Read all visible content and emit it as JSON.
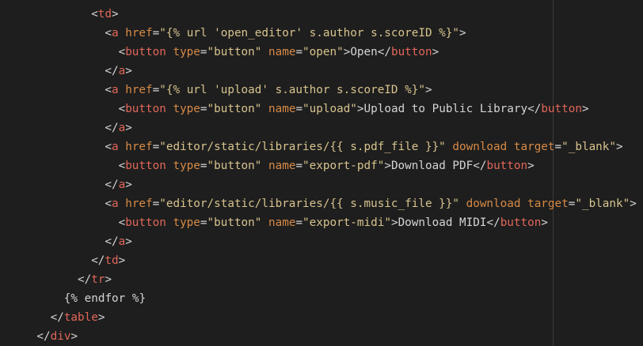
{
  "colors": {
    "background": "#1e1e1e",
    "punctuation": "#d4d4d4",
    "tag": "#e2665a",
    "attribute": "#d78a46",
    "string": "#d7c38e",
    "text": "#d4d4d4"
  },
  "code": {
    "lines": [
      {
        "indent": 12,
        "tokens": [
          {
            "t": "punct",
            "v": "<"
          },
          {
            "t": "tag",
            "v": "td"
          },
          {
            "t": "punct",
            "v": ">"
          }
        ]
      },
      {
        "indent": 14,
        "tokens": [
          {
            "t": "punct",
            "v": "<"
          },
          {
            "t": "tag",
            "v": "a"
          },
          {
            "t": "text",
            "v": " "
          },
          {
            "t": "attr",
            "v": "href"
          },
          {
            "t": "punct",
            "v": "="
          },
          {
            "t": "str",
            "v": "\"{% url 'open_editor' s.author s.scoreID %}\""
          },
          {
            "t": "punct",
            "v": ">"
          }
        ]
      },
      {
        "indent": 16,
        "tokens": [
          {
            "t": "punct",
            "v": "<"
          },
          {
            "t": "tag",
            "v": "button"
          },
          {
            "t": "text",
            "v": " "
          },
          {
            "t": "attr",
            "v": "type"
          },
          {
            "t": "punct",
            "v": "="
          },
          {
            "t": "str",
            "v": "\"button\""
          },
          {
            "t": "text",
            "v": " "
          },
          {
            "t": "attr",
            "v": "name"
          },
          {
            "t": "punct",
            "v": "="
          },
          {
            "t": "str",
            "v": "\"open\""
          },
          {
            "t": "punct",
            "v": ">"
          },
          {
            "t": "text",
            "v": "Open"
          },
          {
            "t": "punct",
            "v": "</"
          },
          {
            "t": "tag",
            "v": "button"
          },
          {
            "t": "punct",
            "v": ">"
          }
        ]
      },
      {
        "indent": 14,
        "tokens": [
          {
            "t": "punct",
            "v": "</"
          },
          {
            "t": "tag",
            "v": "a"
          },
          {
            "t": "punct",
            "v": ">"
          }
        ]
      },
      {
        "indent": 14,
        "tokens": [
          {
            "t": "punct",
            "v": "<"
          },
          {
            "t": "tag",
            "v": "a"
          },
          {
            "t": "text",
            "v": " "
          },
          {
            "t": "attr",
            "v": "href"
          },
          {
            "t": "punct",
            "v": "="
          },
          {
            "t": "str",
            "v": "\"{% url 'upload' s.author s.scoreID %}\""
          },
          {
            "t": "punct",
            "v": ">"
          }
        ]
      },
      {
        "indent": 16,
        "tokens": [
          {
            "t": "punct",
            "v": "<"
          },
          {
            "t": "tag",
            "v": "button"
          },
          {
            "t": "text",
            "v": " "
          },
          {
            "t": "attr",
            "v": "type"
          },
          {
            "t": "punct",
            "v": "="
          },
          {
            "t": "str",
            "v": "\"button\""
          },
          {
            "t": "text",
            "v": " "
          },
          {
            "t": "attr",
            "v": "name"
          },
          {
            "t": "punct",
            "v": "="
          },
          {
            "t": "str",
            "v": "\"upload\""
          },
          {
            "t": "punct",
            "v": ">"
          },
          {
            "t": "text",
            "v": "Upload to Public Library"
          },
          {
            "t": "punct",
            "v": "</"
          },
          {
            "t": "tag",
            "v": "button"
          },
          {
            "t": "punct",
            "v": ">"
          }
        ]
      },
      {
        "indent": 14,
        "tokens": [
          {
            "t": "punct",
            "v": "</"
          },
          {
            "t": "tag",
            "v": "a"
          },
          {
            "t": "punct",
            "v": ">"
          }
        ]
      },
      {
        "indent": 14,
        "tokens": [
          {
            "t": "punct",
            "v": "<"
          },
          {
            "t": "tag",
            "v": "a"
          },
          {
            "t": "text",
            "v": " "
          },
          {
            "t": "attr",
            "v": "href"
          },
          {
            "t": "punct",
            "v": "="
          },
          {
            "t": "str",
            "v": "\"editor/static/libraries/{{ s.pdf_file }}\""
          },
          {
            "t": "text",
            "v": " "
          },
          {
            "t": "attr",
            "v": "download"
          },
          {
            "t": "text",
            "v": " "
          },
          {
            "t": "attr",
            "v": "target"
          },
          {
            "t": "punct",
            "v": "="
          },
          {
            "t": "str",
            "v": "\"_blank\""
          },
          {
            "t": "punct",
            "v": ">"
          }
        ]
      },
      {
        "indent": 16,
        "tokens": [
          {
            "t": "punct",
            "v": "<"
          },
          {
            "t": "tag",
            "v": "button"
          },
          {
            "t": "text",
            "v": " "
          },
          {
            "t": "attr",
            "v": "type"
          },
          {
            "t": "punct",
            "v": "="
          },
          {
            "t": "str",
            "v": "\"button\""
          },
          {
            "t": "text",
            "v": " "
          },
          {
            "t": "attr",
            "v": "name"
          },
          {
            "t": "punct",
            "v": "="
          },
          {
            "t": "str",
            "v": "\"export-pdf\""
          },
          {
            "t": "punct",
            "v": ">"
          },
          {
            "t": "text",
            "v": "Download PDF"
          },
          {
            "t": "punct",
            "v": "</"
          },
          {
            "t": "tag",
            "v": "button"
          },
          {
            "t": "punct",
            "v": ">"
          }
        ]
      },
      {
        "indent": 14,
        "tokens": [
          {
            "t": "punct",
            "v": "</"
          },
          {
            "t": "tag",
            "v": "a"
          },
          {
            "t": "punct",
            "v": ">"
          }
        ]
      },
      {
        "indent": 14,
        "tokens": [
          {
            "t": "punct",
            "v": "<"
          },
          {
            "t": "tag",
            "v": "a"
          },
          {
            "t": "text",
            "v": " "
          },
          {
            "t": "attr",
            "v": "href"
          },
          {
            "t": "punct",
            "v": "="
          },
          {
            "t": "str",
            "v": "\"editor/static/libraries/{{ s.music_file }}\""
          },
          {
            "t": "text",
            "v": " "
          },
          {
            "t": "attr",
            "v": "download"
          },
          {
            "t": "text",
            "v": " "
          },
          {
            "t": "attr",
            "v": "target"
          },
          {
            "t": "punct",
            "v": "="
          },
          {
            "t": "str",
            "v": "\"_blank\""
          },
          {
            "t": "punct",
            "v": ">"
          }
        ]
      },
      {
        "indent": 16,
        "tokens": [
          {
            "t": "punct",
            "v": "<"
          },
          {
            "t": "tag",
            "v": "button"
          },
          {
            "t": "text",
            "v": " "
          },
          {
            "t": "attr",
            "v": "type"
          },
          {
            "t": "punct",
            "v": "="
          },
          {
            "t": "str",
            "v": "\"button\""
          },
          {
            "t": "text",
            "v": " "
          },
          {
            "t": "attr",
            "v": "name"
          },
          {
            "t": "punct",
            "v": "="
          },
          {
            "t": "str",
            "v": "\"export-midi\""
          },
          {
            "t": "punct",
            "v": ">"
          },
          {
            "t": "text",
            "v": "Download MIDI"
          },
          {
            "t": "punct",
            "v": "</"
          },
          {
            "t": "tag",
            "v": "button"
          },
          {
            "t": "punct",
            "v": ">"
          }
        ]
      },
      {
        "indent": 14,
        "tokens": [
          {
            "t": "punct",
            "v": "</"
          },
          {
            "t": "tag",
            "v": "a"
          },
          {
            "t": "punct",
            "v": ">"
          }
        ]
      },
      {
        "indent": 12,
        "tokens": [
          {
            "t": "punct",
            "v": "</"
          },
          {
            "t": "tag",
            "v": "td"
          },
          {
            "t": "punct",
            "v": ">"
          }
        ]
      },
      {
        "indent": 10,
        "tokens": [
          {
            "t": "punct",
            "v": "</"
          },
          {
            "t": "tag",
            "v": "tr"
          },
          {
            "t": "punct",
            "v": ">"
          }
        ]
      },
      {
        "indent": 8,
        "tokens": [
          {
            "t": "tmpl",
            "v": "{% endfor %}"
          }
        ]
      },
      {
        "indent": 6,
        "tokens": [
          {
            "t": "punct",
            "v": "</"
          },
          {
            "t": "tag",
            "v": "table"
          },
          {
            "t": "punct",
            "v": ">"
          }
        ]
      },
      {
        "indent": 4,
        "tokens": [
          {
            "t": "punct",
            "v": "</"
          },
          {
            "t": "tag",
            "v": "div"
          },
          {
            "t": "punct",
            "v": ">"
          }
        ]
      }
    ]
  }
}
